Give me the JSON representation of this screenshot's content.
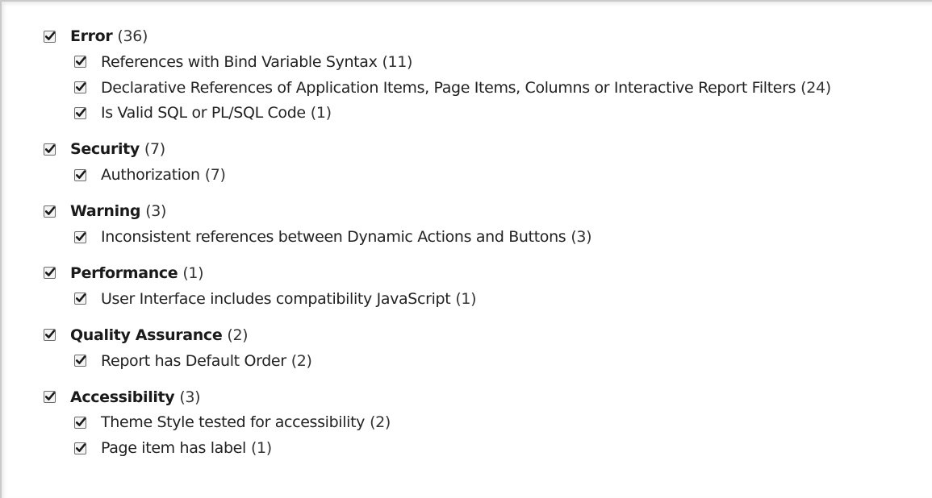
{
  "groups": [
    {
      "label": "Error",
      "count": "(36)",
      "checked": true,
      "items": [
        {
          "label": "References with Bind Variable Syntax",
          "count": "(11)",
          "checked": true
        },
        {
          "label": "Declarative References of Application Items, Page Items, Columns or Interactive Report Filters",
          "count": "(24)",
          "checked": true
        },
        {
          "label": "Is Valid SQL or PL/SQL Code",
          "count": "(1)",
          "checked": true
        }
      ]
    },
    {
      "label": "Security",
      "count": "(7)",
      "checked": true,
      "items": [
        {
          "label": "Authorization",
          "count": "(7)",
          "checked": true
        }
      ]
    },
    {
      "label": "Warning",
      "count": "(3)",
      "checked": true,
      "items": [
        {
          "label": "Inconsistent references between Dynamic Actions and Buttons",
          "count": "(3)",
          "checked": true
        }
      ]
    },
    {
      "label": "Performance",
      "count": "(1)",
      "checked": true,
      "items": [
        {
          "label": "User Interface includes compatibility JavaScript",
          "count": "(1)",
          "checked": true
        }
      ]
    },
    {
      "label": "Quality Assurance",
      "count": "(2)",
      "checked": true,
      "items": [
        {
          "label": "Report has Default Order",
          "count": "(2)",
          "checked": true
        }
      ]
    },
    {
      "label": "Accessibility",
      "count": "(3)",
      "checked": true,
      "items": [
        {
          "label": "Theme Style tested for accessibility",
          "count": "(2)",
          "checked": true
        },
        {
          "label": "Page item has label",
          "count": "(1)",
          "checked": true
        }
      ]
    }
  ],
  "icons": {
    "checkbox_checked": "checkmark-icon"
  },
  "colors": {
    "check": "#1a1a1a",
    "checkbox_border": "#6a6a6a",
    "checkbox_bg": "#f4f4f4"
  }
}
